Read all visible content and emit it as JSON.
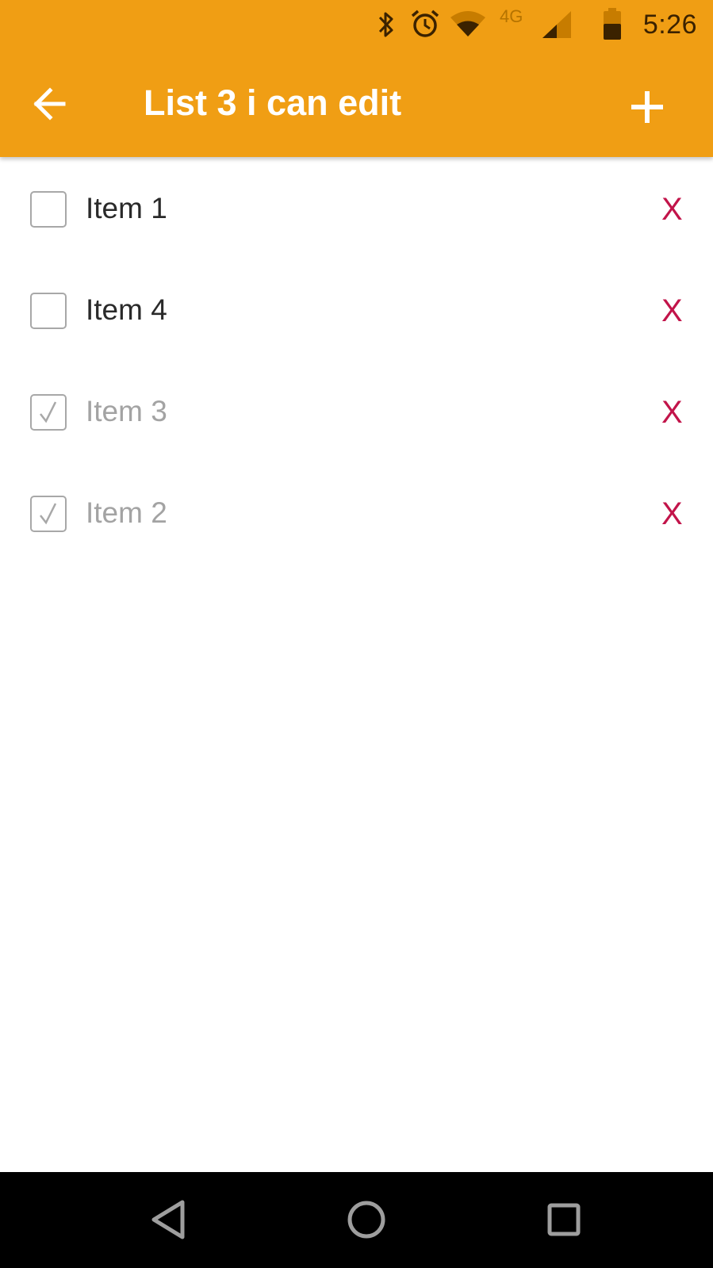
{
  "status_bar": {
    "time": "5:26",
    "network": "4G",
    "icons": [
      "bluetooth-icon",
      "alarm-icon",
      "wifi-icon",
      "cell-signal-icon",
      "battery-icon"
    ]
  },
  "toolbar": {
    "title": "List 3 i can edit",
    "back_icon": "arrow-left-icon",
    "add_icon": "plus-icon",
    "color": "#F09E14"
  },
  "items": [
    {
      "label": "Item 1",
      "checked": false,
      "delete_label": "X"
    },
    {
      "label": "Item 4",
      "checked": false,
      "delete_label": "X"
    },
    {
      "label": "Item 3",
      "checked": true,
      "delete_label": "X"
    },
    {
      "label": "Item 2",
      "checked": true,
      "delete_label": "X"
    }
  ],
  "colors": {
    "accent": "#F09E14",
    "delete": "#C2144A",
    "checked_text": "#A3A3A3"
  },
  "nav_bar": {
    "buttons": [
      "back-triangle-icon",
      "home-circle-icon",
      "recents-square-icon"
    ]
  }
}
